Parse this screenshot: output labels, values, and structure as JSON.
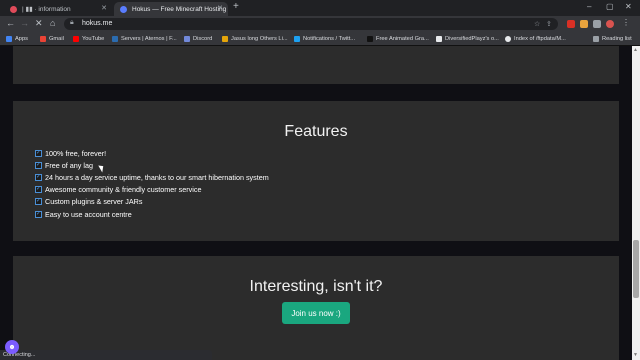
{
  "browser": {
    "tabs": [
      {
        "title": "| ▮▮ · information",
        "active": false,
        "favicon_color": "#e04b5a"
      },
      {
        "title": "Hokus — Free Minecraft Hosting",
        "active": true,
        "favicon_color": "#5a7dff"
      }
    ],
    "url": "hokus.me",
    "bookmarks": [
      {
        "label": "Apps",
        "icon": "apps-grid-icon",
        "color": "#4285f4"
      },
      {
        "label": "Gmail",
        "icon": "gmail-icon",
        "color": "#ea4335"
      },
      {
        "label": "YouTube",
        "icon": "youtube-icon",
        "color": "#ff0000"
      },
      {
        "label": "Servers | Aternos | F...",
        "icon": "aternos-icon",
        "color": "#2b6cb0"
      },
      {
        "label": "Discord",
        "icon": "discord-icon",
        "color": "#7289da"
      },
      {
        "label": "Jasus long Others Li...",
        "icon": "bookmark-icon",
        "color": "#e5a50a"
      },
      {
        "label": "Notifications / Twitt...",
        "icon": "twitter-icon",
        "color": "#1da1f2"
      },
      {
        "label": "Free Animated Gra...",
        "icon": "bookmark-icon",
        "color": "#111111"
      },
      {
        "label": "DiversifiedPlayz's o...",
        "icon": "bookmark-icon",
        "color": "#e8eaed"
      },
      {
        "label": "Index of /ftpdata/M...",
        "icon": "globe-icon",
        "color": "#e8eaed"
      }
    ],
    "reading_list": "Reading list",
    "status_text": "Connecting..."
  },
  "page": {
    "features": {
      "title": "Features",
      "items": [
        "100% free, forever!",
        "Free of any lag",
        "24 hours a day service uptime, thanks to our smart hibernation system",
        "Awesome community & friendly customer service",
        "Custom plugins & server JARs",
        "Easy to use account centre"
      ]
    },
    "interest": {
      "title": "Interesting, isn't it?",
      "button_label": "Join us now :)",
      "button_color": "#1aa77f"
    }
  }
}
